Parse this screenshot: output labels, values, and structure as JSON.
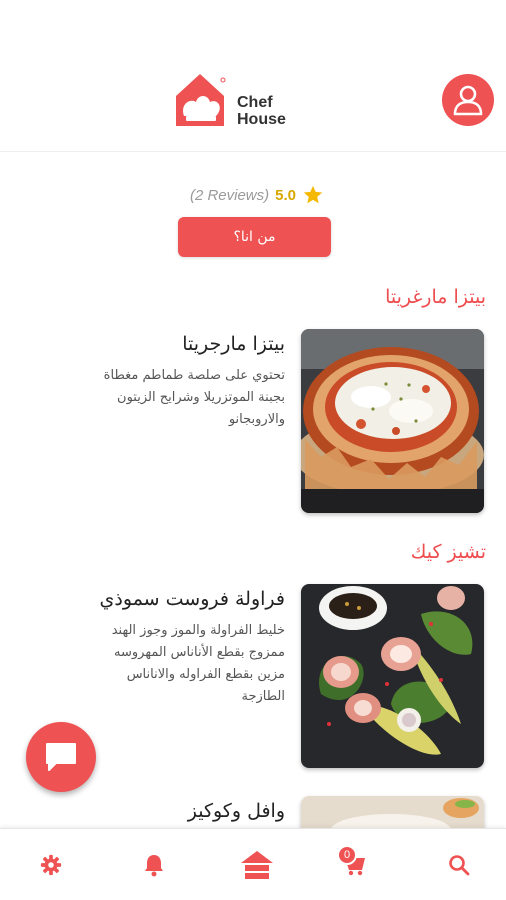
{
  "header": {
    "brand": {
      "line1": "Chef",
      "line2": "House"
    },
    "icons": {
      "logo": "chef-hat-house-icon",
      "profile": "user-icon"
    }
  },
  "store": {
    "reviews_text": "(2 Reviews)",
    "rating": "5.0",
    "about_label": "من انا؟"
  },
  "sections": [
    {
      "title": "بيتزا مارغريتا",
      "item": {
        "name": "بيتزا مارجريتا",
        "description": "تحتوي على صلصة طماطم مغطاة بجبنة الموتزريلا وشرايح الزيتون والاروبجانو"
      }
    },
    {
      "title": "تشيز كيك",
      "item": {
        "name": "فراولة فروست سموذي",
        "description": "خليط الفراولة والموز وجوز الهند ممزوج بقطع الأناناس المهروسه مزين بقطع الفراوله والاناناس الطازجة"
      }
    },
    {
      "item": {
        "name": "وافل وكوكيز"
      }
    }
  ],
  "bottom_nav": {
    "cart_badge": "0",
    "icons": [
      "gear-icon",
      "bell-icon",
      "home-icon",
      "cart-icon",
      "search-icon"
    ]
  },
  "colors": {
    "accent": "#ee5253",
    "star": "#f5b800"
  }
}
